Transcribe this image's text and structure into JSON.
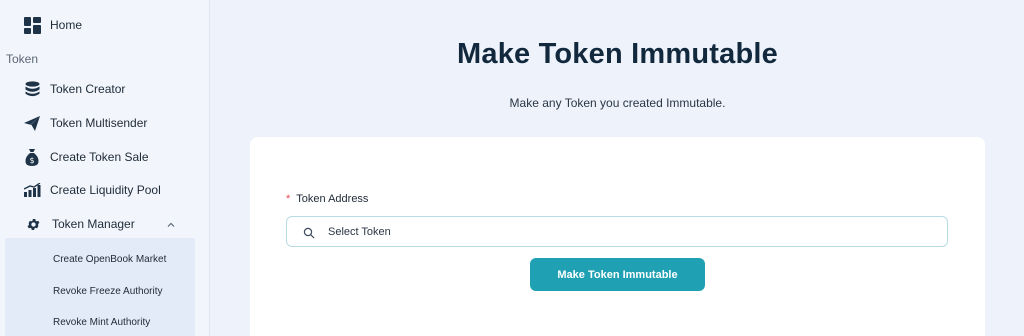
{
  "sidebar": {
    "home_label": "Home",
    "section_label": "Token",
    "items": [
      {
        "label": "Token Creator",
        "icon": "database-icon"
      },
      {
        "label": "Token Multisender",
        "icon": "send-icon"
      },
      {
        "label": "Create Token Sale",
        "icon": "money-bag-icon"
      },
      {
        "label": "Create Liquidity Pool",
        "icon": "bar-chart-icon"
      },
      {
        "label": "Token Manager",
        "icon": "gear-icon"
      }
    ],
    "submenu": [
      {
        "label": "Create OpenBook Market"
      },
      {
        "label": "Revoke Freeze Authority"
      },
      {
        "label": "Revoke Mint Authority"
      }
    ]
  },
  "main": {
    "title": "Make Token Immutable",
    "subtitle": "Make any Token you created Immutable.",
    "field_label": "Token Address",
    "required_mark": "*",
    "select_placeholder": "Select Token",
    "button_label": "Make Token Immutable"
  },
  "colors": {
    "accent": "#20a1b3",
    "title": "#12293d",
    "background": "#eef3fb",
    "submenu_bg": "#e4ebf8"
  }
}
